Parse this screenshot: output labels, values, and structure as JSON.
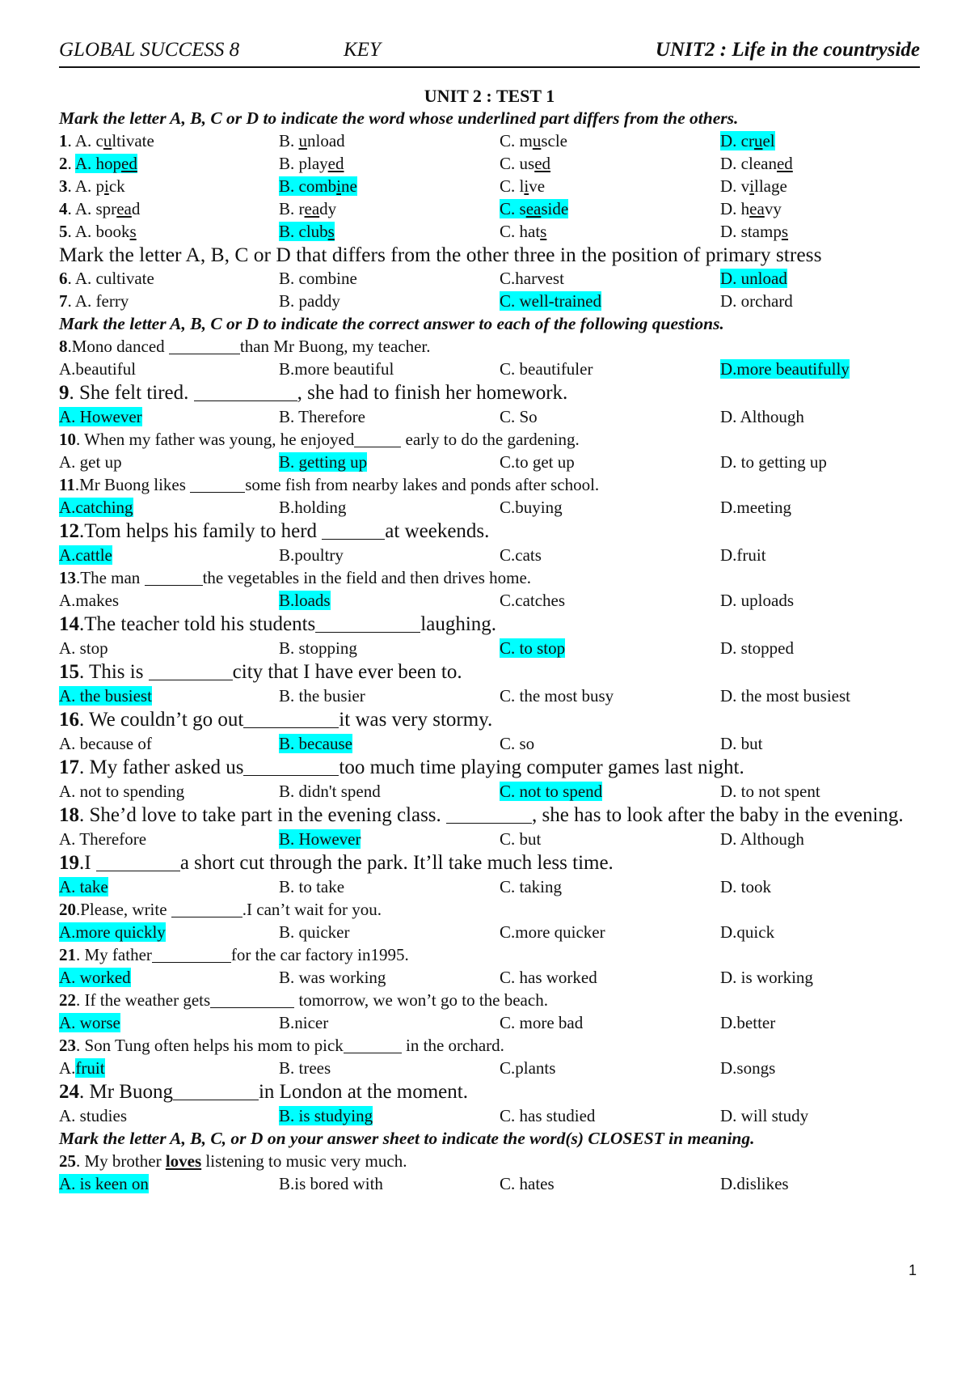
{
  "header": {
    "left": "GLOBAL SUCCESS 8",
    "middle": "KEY",
    "right": "UNIT2 : Life in the countryside"
  },
  "test_title": "UNIT 2 : TEST 1",
  "highlight_color": "#00ffff",
  "sections": {
    "pronunciation": {
      "instruction": "Mark the letter A, B, C or D to indicate the word whose underlined part differs from the others.",
      "questions": [
        {
          "number": "1",
          "options": [
            {
              "letter": "A. ",
              "pre": "c",
              "u": "u",
              "post": "ltivate"
            },
            {
              "letter": "B. ",
              "pre": "",
              "u": "u",
              "post": "nload"
            },
            {
              "letter": "C. ",
              "pre": "m",
              "u": "u",
              "post": "scle"
            },
            {
              "letter": "D. ",
              "pre": "cr",
              "u": "u",
              "post": "el"
            }
          ],
          "answer": "D"
        },
        {
          "number": "2",
          "options": [
            {
              "letter": "A. ",
              "pre": "hop",
              "u": "ed",
              "post": ""
            },
            {
              "letter": "B. ",
              "pre": "play",
              "u": "ed",
              "post": ""
            },
            {
              "letter": "C. ",
              "pre": "us",
              "u": "ed",
              "post": ""
            },
            {
              "letter": "D. ",
              "pre": "clean",
              "u": "ed",
              "post": ""
            }
          ],
          "answer": "A"
        },
        {
          "number": "3",
          "options": [
            {
              "letter": "A. ",
              "pre": "p",
              "u": "i",
              "post": "ck"
            },
            {
              "letter": "B. ",
              "pre": "comb",
              "u": "i",
              "post": "ne"
            },
            {
              "letter": "C. ",
              "pre": "l",
              "u": "i",
              "post": "ve"
            },
            {
              "letter": "D. ",
              "pre": "v",
              "u": "i",
              "post": "llage"
            }
          ],
          "answer": "B"
        },
        {
          "number": "4",
          "options": [
            {
              "letter": "A. ",
              "pre": "spr",
              "u": "ea",
              "post": "d"
            },
            {
              "letter": "B. ",
              "pre": "r",
              "u": "ea",
              "post": "dy"
            },
            {
              "letter": "C. ",
              "pre": "s",
              "u": "ea",
              "post": "side"
            },
            {
              "letter": "D. ",
              "pre": "h",
              "u": "ea",
              "post": "vy"
            }
          ],
          "answer": "C"
        },
        {
          "number": "5",
          "options": [
            {
              "letter": "A. ",
              "pre": "book",
              "u": "s",
              "post": ""
            },
            {
              "letter": "B. ",
              "pre": "club",
              "u": "s",
              "post": ""
            },
            {
              "letter": "C. ",
              "pre": "hat",
              "u": "s",
              "post": ""
            },
            {
              "letter": "D. ",
              "pre": "stamp",
              "u": "s",
              "post": ""
            }
          ],
          "answer": "B"
        }
      ]
    },
    "stress": {
      "instruction": "Mark the letter A, B, C or D that differs from the other three in the position of primary stress",
      "questions": [
        {
          "number": "6",
          "options": [
            "A. cultivate",
            "B. combine",
            "C.harvest",
            "D. unload"
          ],
          "answer": "D"
        },
        {
          "number": "7",
          "options": [
            "A. ferry",
            "B. paddy",
            "C. well-trained",
            "D. orchard"
          ],
          "answer": "C"
        }
      ]
    },
    "grammar": {
      "instruction": "Mark the letter A, B, C or D to indicate the correct answer to each of the following questions.",
      "questions": [
        {
          "number": "8",
          "sep": ".",
          "before": "Mono danced ",
          "after": "than Mr Buong, my teacher.",
          "options": [
            "A.beautiful",
            "B.more beautiful",
            "C. beautifuler",
            "D.more beautifully"
          ],
          "answer": "D"
        },
        {
          "number": "9",
          "sep": ". ",
          "before": "She felt tired. ",
          "after": ", she had to finish her homework.",
          "options": [
            "A. However",
            "B. Therefore",
            "C. So",
            "D. Although"
          ],
          "answer": "A"
        },
        {
          "number": "10",
          "sep": ". ",
          "before": "When my father was young, he enjoyed",
          "after": " early to do the gardening.",
          "options": [
            "A. get up",
            "B. getting up",
            "C.to get up",
            "D. to getting up"
          ],
          "answer": "B"
        },
        {
          "number": "11",
          "sep": ".",
          "before": "Mr Buong likes ",
          "after": "some fish from nearby lakes and ponds after school.",
          "options": [
            "A.catching",
            "B.holding",
            "C.buying",
            "D.meeting"
          ],
          "answer": "A"
        },
        {
          "number": "12",
          "sep": ".",
          "before": "Tom helps his family to herd ",
          "after": "at weekends.",
          "options": [
            "A.cattle",
            "B.poultry",
            "C.cats",
            "D.fruit"
          ],
          "answer": "A"
        },
        {
          "number": "13",
          "sep": ".",
          "before": "The man ",
          "after": "the vegetables in the field and then drives home.",
          "options": [
            "A.makes",
            "B.loads",
            "C.catches",
            "D. uploads"
          ],
          "answer": "B"
        },
        {
          "number": "14",
          "sep": ".",
          "before": "The teacher told his students",
          "after": "laughing.",
          "options": [
            "A. stop",
            "B. stopping",
            "C. to stop",
            "D. stopped"
          ],
          "answer": "C"
        },
        {
          "number": "15",
          "sep": ".  ",
          "before": "This is ",
          "after": "city that I have ever been to.",
          "options": [
            "A. the busiest",
            "B. the busier",
            "C. the most busy",
            "D. the most busiest"
          ],
          "answer": "A"
        },
        {
          "number": "16",
          "sep": ". ",
          "before": "We couldn’t go out",
          "after": "it was very  stormy.",
          "options": [
            "A. because of",
            "B. because",
            "C. so",
            "D. but"
          ],
          "answer": "B"
        },
        {
          "number": "17",
          "sep": ". ",
          "before": "My father asked us",
          "after": "too much time playing computer games last night.",
          "options": [
            "A. not to spending",
            "B. didn't spend",
            "C. not to spend",
            "D. to not spent"
          ],
          "answer": "C"
        },
        {
          "number": "18",
          "sep": ".   ",
          "before": "She’d love to take part in the evening class. ",
          "after": ", she has to look after the baby in the evening.",
          "options": [
            "A. Therefore",
            "B. However",
            "C. but",
            "D. Although"
          ],
          "answer": "B"
        },
        {
          "number": "19",
          "sep": ".",
          "before": "I ",
          "after": "a short cut through the park. It’ll take much less time.",
          "options": [
            "A. take",
            "B. to take",
            "C. taking",
            "D. took"
          ],
          "answer": "A"
        },
        {
          "number": "20",
          "sep": ".",
          "before": "Please, write ",
          "after": ".I can’t wait for you.",
          "options": [
            "A.more quickly",
            "B. quicker",
            "C.more quicker",
            "D.quick"
          ],
          "answer": "A"
        },
        {
          "number": "21",
          "sep": ". ",
          "before": "My father",
          "after": "for the car factory in1995.",
          "options": [
            "A. worked",
            "B. was working",
            "C. has worked",
            "D. is working"
          ],
          "answer": "A"
        },
        {
          "number": "22",
          "sep": ". ",
          "before": "If the weather gets",
          "after": " tomorrow, we won’t go to the beach.",
          "options": [
            "A. worse",
            "B.nicer",
            "C. more bad",
            "D.better"
          ],
          "answer": "A"
        },
        {
          "number": "23",
          "sep": ". ",
          "before": "Son Tung often helps his mom to pick",
          "after": " in the orchard.",
          "options": [
            "A.fruit",
            "B. trees",
            "C.plants",
            "D.songs"
          ],
          "answer": "A"
        },
        {
          "number": "24",
          "sep": ". ",
          "before": "Mr Buong",
          "after": "in London at the moment.",
          "options": [
            "A. studies",
            "B. is studying",
            "C. has studied",
            "D. will study"
          ],
          "answer": "B"
        }
      ]
    },
    "synonym": {
      "instruction": "Mark the letter A, B, C, or D on your answer sheet to indicate the word(s) CLOSEST in meaning.",
      "questions": [
        {
          "number": "25",
          "sep": ". ",
          "before": "My brother ",
          "keyword": "loves",
          "after": " listening  to music very much.",
          "options": [
            "A. is keen on",
            "B.is bored with",
            "C. hates",
            "D.dislikes"
          ],
          "answer": "A"
        }
      ]
    }
  },
  "page_number": "1"
}
